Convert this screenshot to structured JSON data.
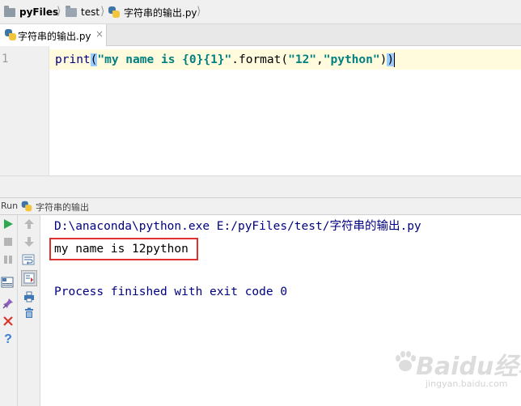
{
  "breadcrumb": {
    "items": [
      "pyFiles",
      "test",
      "字符串的输出.py"
    ]
  },
  "editor": {
    "tab_label": "字符串的输出.py",
    "tab_close": "×",
    "line_number": "1",
    "code": {
      "fn": "print",
      "open_paren": "(",
      "string1": "\"my name is {0}{1}\"",
      "dot_format": ".format(",
      "string2": "\"12\"",
      "comma": ",",
      "string3": "\"python\"",
      "close_inner": ")",
      "close_outer": ")"
    }
  },
  "run_panel": {
    "label": "Run",
    "tab_label": "字符串的输出",
    "console_lines": {
      "command": "D:\\anaconda\\python.exe E:/pyFiles/test/字符串的输出.py",
      "output": "my name is 12python",
      "exit": "Process finished with exit code 0"
    }
  },
  "toolbar_icons": {
    "left": [
      "run-icon",
      "stop-icon",
      "pause-icon",
      "layout-icon",
      "pin-icon",
      "close-icon",
      "help-icon"
    ],
    "right": [
      "up-arrow-icon",
      "down-arrow-icon",
      "soft-wrap-icon",
      "scroll-to-end-icon",
      "print-icon",
      "trash-icon"
    ]
  },
  "colors": {
    "console_command": "#000080",
    "string_literal": "#008080",
    "highlight_box": "#e03131",
    "run_green": "#2fa84f"
  },
  "watermark": {
    "main": "Baidu经验",
    "sub": "jingyan.baidu.com"
  }
}
